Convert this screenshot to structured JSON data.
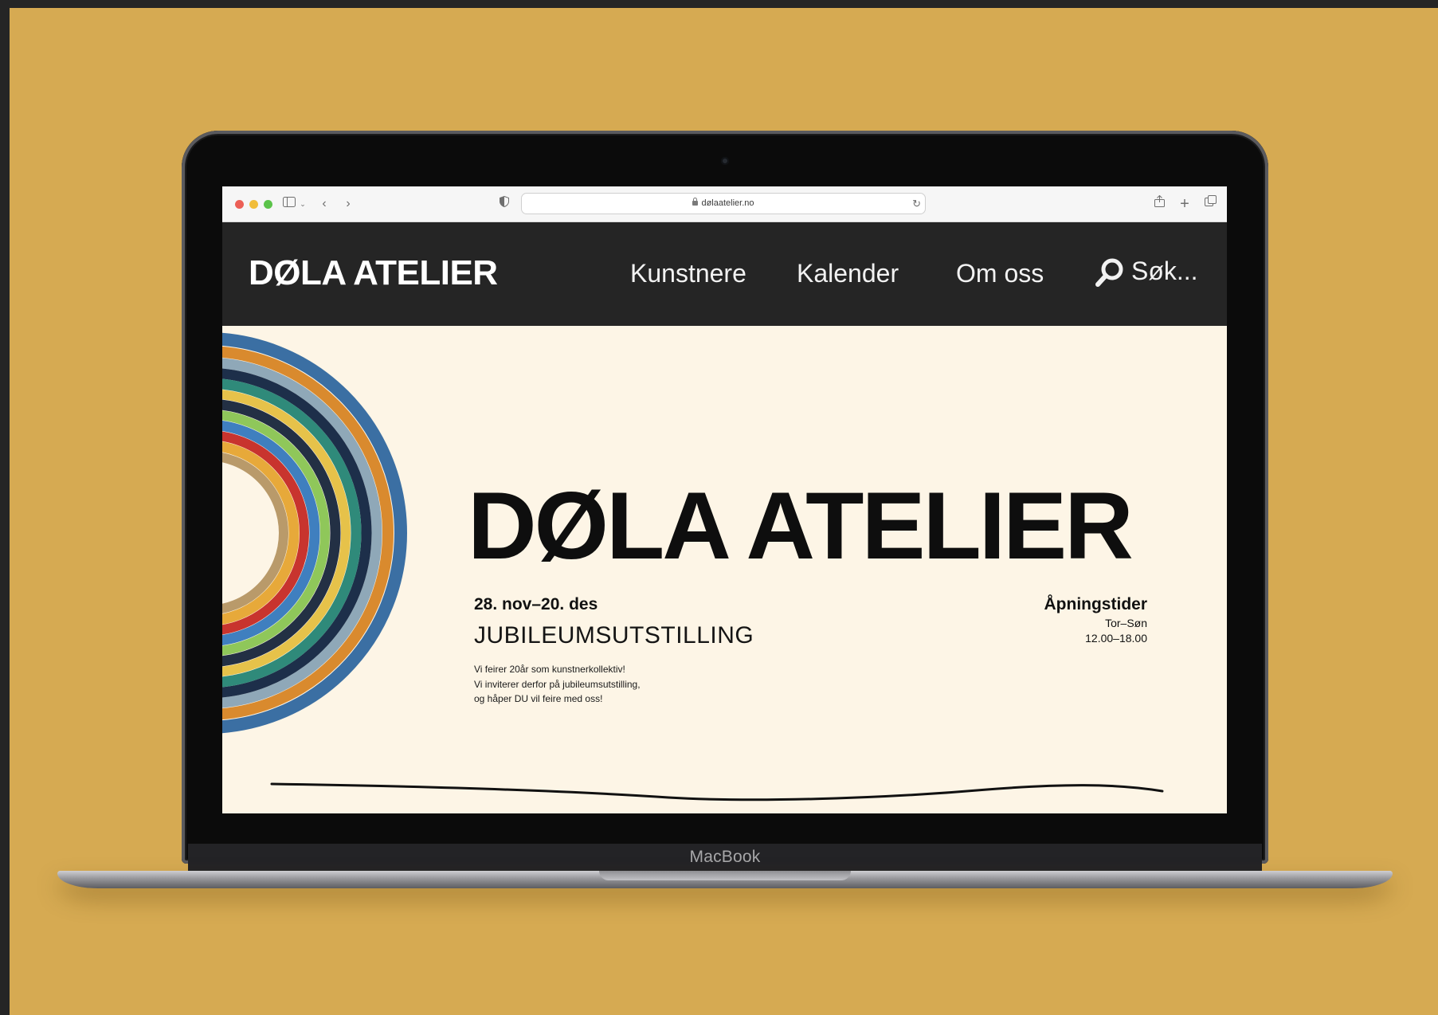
{
  "browser": {
    "url": "dølaatelier.no"
  },
  "site": {
    "logo": "DØLA ATELIER",
    "nav": [
      {
        "label": "Kunstnere"
      },
      {
        "label": "Kalender"
      },
      {
        "label": "Om oss"
      }
    ],
    "search_label": "Søk..."
  },
  "hero": {
    "title": "DØLA ATELIER",
    "dates": "28. nov–20. des",
    "exhibition": "JUBILEUMSUTSTILLING",
    "body_lines": [
      "Vi feirer 20år som kunstnerkollektiv!",
      "Vi inviterer derfor på jubileumsutstilling,",
      "og håper DU vil feire med oss!"
    ],
    "hours": {
      "title": "Åpningstider",
      "days": "Tor–Søn",
      "times": "12.00–18.00"
    }
  },
  "device": {
    "brand": "MacBook"
  },
  "colors": {
    "backdrop": "#d6aa52",
    "header_bg": "#252525",
    "page_bg": "#fdf5e6",
    "text": "#0e0e0e"
  }
}
